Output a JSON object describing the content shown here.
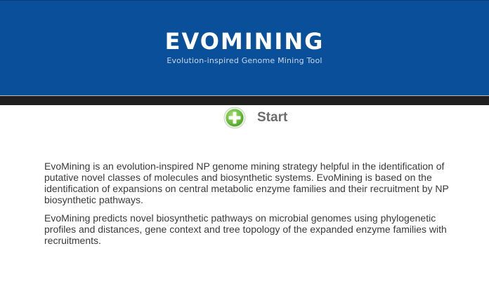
{
  "header": {
    "title": "EVOMINING",
    "subtitle": "Evolution-inspired Genome Mining Tool",
    "background_color": "#0a4f9a"
  },
  "start": {
    "label": "Start",
    "icon": "plus-circle-icon",
    "icon_color": "#6fbf3f"
  },
  "main": {
    "paragraphs": [
      "EvoMining is an evolution-inspired NP genome mining strategy helpful in the identification of putative novel classes of molecules and biosynthetic systems. EvoMining is based on the identification of expansions on central metabolic enzyme families and their recruitment by NP biosynthetic pathways.",
      "EvoMining predicts novel biosynthetic pathways on microbial genomes using phylogenetic profiles and distances, gene context and tree topology of the expanded enzyme families with recruitments."
    ]
  }
}
